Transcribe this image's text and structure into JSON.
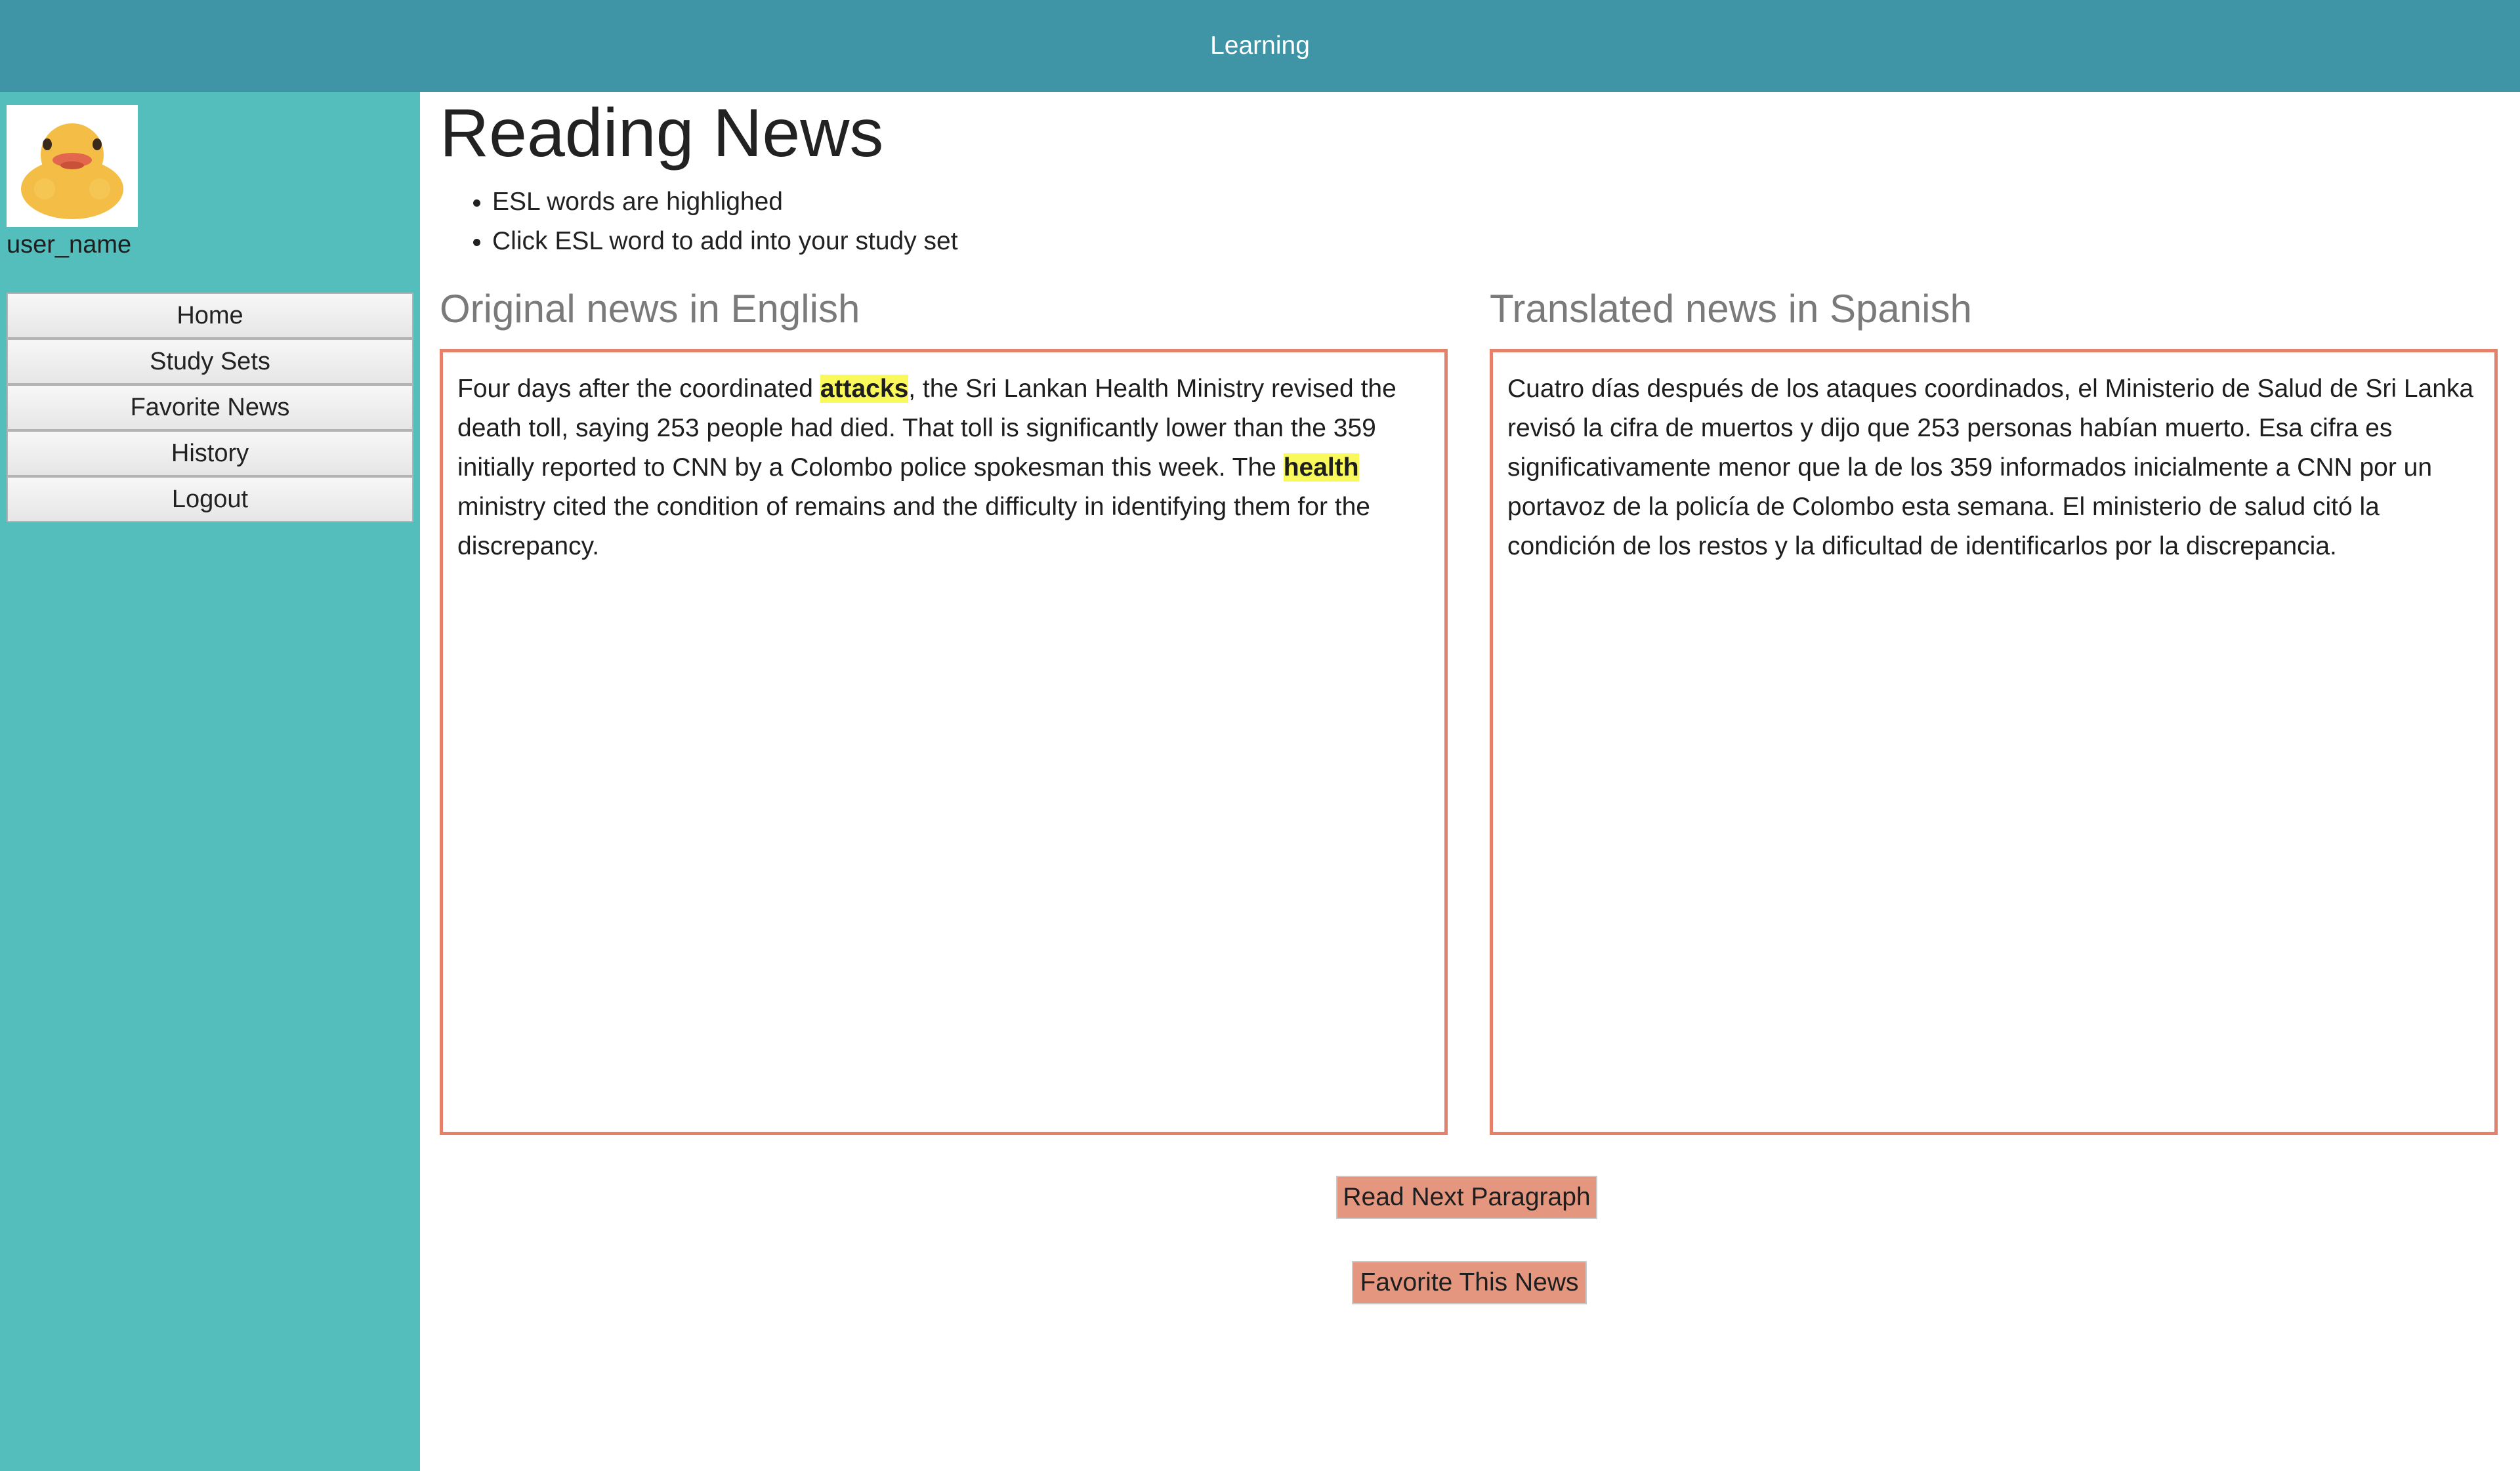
{
  "header": {
    "title": "Learning"
  },
  "sidebar": {
    "avatar_icon": "rubber-duck",
    "username": "user_name",
    "nav": [
      {
        "label": "Home"
      },
      {
        "label": "Study Sets"
      },
      {
        "label": "Favorite News"
      },
      {
        "label": "History"
      },
      {
        "label": "Logout"
      }
    ]
  },
  "main": {
    "title": "Reading News",
    "instructions": [
      "ESL words are highlighed",
      "Click ESL word to add into your study set"
    ],
    "original": {
      "heading": "Original news in English",
      "text_1": "Four days after the coordinated ",
      "highlight_1": "attacks",
      "text_2": ", the Sri Lankan Health Ministry revised the death toll, saying 253 people had died. That toll is significantly lower than the 359 initially reported to CNN by a Colombo police spokesman this week. The ",
      "highlight_2": "health",
      "text_3": " ministry cited the condition of remains and the difficulty in identifying them for the discrepancy."
    },
    "translated": {
      "heading": "Translated news in Spanish",
      "text": "Cuatro días después de los ataques coordinados, el Ministerio de Salud de Sri Lanka revisó la cifra de muertos y dijo que 253 personas habían muerto. Esa cifra es significativamente menor que la de los 359 informados inicialmente a CNN por un portavoz de la policía de Colombo esta semana. El ministerio de salud citó la condición de los restos y la dificultad de identificarlos por la discrepancia."
    },
    "buttons": {
      "next_paragraph": "Read Next Paragraph",
      "favorite": "Favorite This News"
    }
  },
  "colors": {
    "header_bg": "#3f95a6",
    "sidebar_bg": "#54bebd",
    "box_border": "#e5816a",
    "button_bg": "#e5967f",
    "highlight": "#faf95b"
  }
}
